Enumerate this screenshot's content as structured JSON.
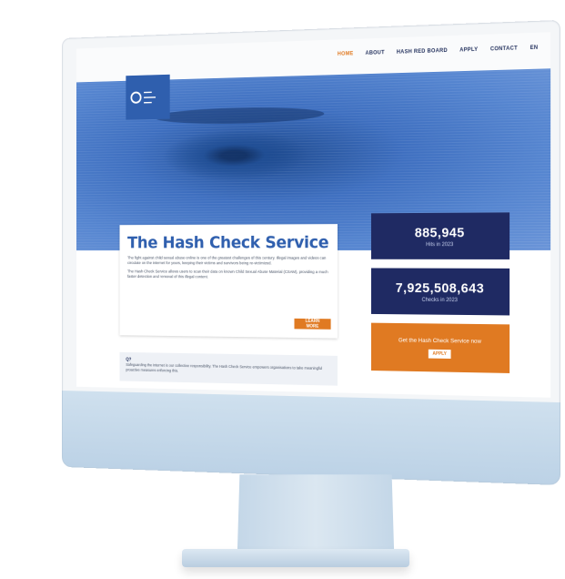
{
  "nav": {
    "items": [
      "HOME",
      "ABOUT",
      "HASH RED BOARD",
      "APPLY",
      "CONTACT",
      "EN"
    ]
  },
  "hero": {
    "title": "The Hash Check Service",
    "paragraph1": "The fight against child sexual abuse online is one of the greatest challenges of this century. Illegal images and videos can circulate on the internet for years, keeping their victims and survivors being re-victimized.",
    "paragraph2": "The Hash Check Service allows users to scan their data on known Child Sexual Abuse Material (CSAM), providing a much faster detection and removal of this illegal content.",
    "learn_more": "LEARN MORE"
  },
  "stats": [
    {
      "value": "885,945",
      "label": "Hits in 2023"
    },
    {
      "value": "7,925,508,643",
      "label": "Checks in 2023"
    }
  ],
  "cta": {
    "text": "Get the Hash Check Service now",
    "button": "APPLY"
  },
  "lower": {
    "question": "Q?",
    "text": "Safeguarding the internet is our collective responsibility. The Hash Check Service empowers organisations to take meaningful proactive measures enforcing this."
  },
  "colors": {
    "primary": "#2f5fae",
    "dark": "#1f2a63",
    "accent": "#e07a22"
  }
}
